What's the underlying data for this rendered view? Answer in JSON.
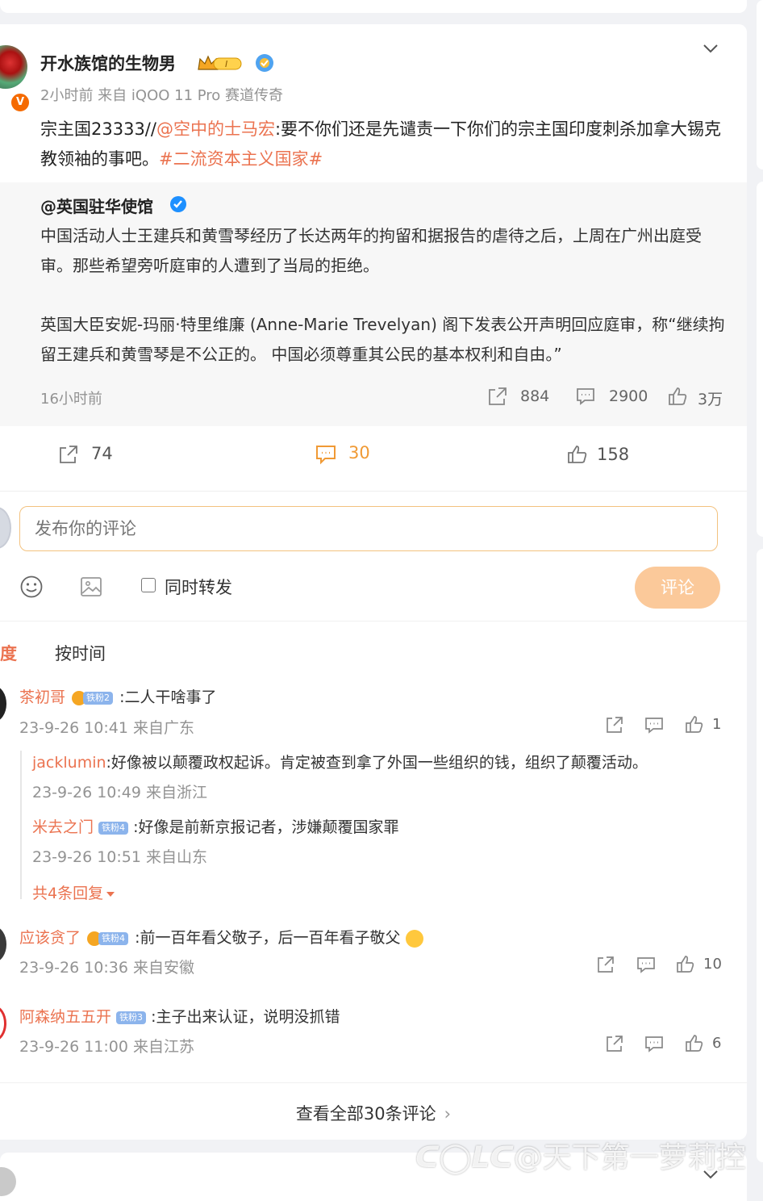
{
  "post": {
    "author": "开水族馆的生物男",
    "meta": "2小时前 来自 iQOO 11 Pro 赛道传奇",
    "text_prefix": "宗主国23333//",
    "mention": "@空中的士马宏",
    "text_body": ":要不你们还是先谴责一下你们的宗主国印度刺杀加拿大锡克教领袖的事吧。",
    "hashtag": "#二流资本主义国家#"
  },
  "repost": {
    "author": "@英国驻华使馆",
    "para1": "中国活动人士王建兵和黄雪琴经历了长达两年的拘留和据报告的虐待之后，上周在广州出庭受审。那些希望旁听庭审的人遭到了当局的拒绝。",
    "para2": "英国大臣安妮-玛丽·特里维廉 (Anne-Marie Trevelyan) 阁下发表公开声明回应庭审，称“继续拘留王建兵和黄雪琴是不公正的。 中国必须尊重其公民的基本权利和自由。”",
    "time": "16小时前",
    "shares": "884",
    "comments": "2900",
    "likes": "3万"
  },
  "actions": {
    "shares": "74",
    "comments": "30",
    "likes": "158"
  },
  "composer": {
    "placeholder": "发布你的评论",
    "repost_label": "同时转发",
    "submit": "评论"
  },
  "sort": {
    "hot": "度",
    "time": "按时间"
  },
  "comments": [
    {
      "user": "茶初哥",
      "fan_badge": "铁粉2",
      "text": ":二人干啥事了",
      "meta": "23-9-26 10:41 来自广东",
      "likes": "1",
      "replies": [
        {
          "user": "jacklumin",
          "text": ":好像被以颠覆政权起诉。肯定被查到拿了外国一些组织的钱，组织了颠覆活动。",
          "meta": "23-9-26 10:49 来自浙江"
        },
        {
          "user": "米去之门",
          "fan_badge": "铁粉4",
          "text": ":好像是前新京报记者，涉嫌颠覆国家罪",
          "meta": "23-9-26 10:51 来自山东"
        }
      ],
      "more": "共4条回复"
    },
    {
      "user": "应该贪了",
      "fan_badge": "铁粉4",
      "text": ":前一百年看父敬子，后一百年看子敬父",
      "meta": "23-9-26 10:36 来自安徽",
      "likes": "10"
    },
    {
      "user": "阿森纳五五开",
      "fan_badge": "铁粉3",
      "text": ":主子出来认证，说明没抓错",
      "meta": "23-9-26 11:00 来自江苏",
      "likes": "6"
    }
  ],
  "view_all": "查看全部30条评论",
  "watermark": "@天下第一萝莉控",
  "colors": {
    "accent": "#eb7350",
    "link": "#eb7350",
    "submit_bg": "#fbc99a",
    "verified": "#1e90ff"
  }
}
